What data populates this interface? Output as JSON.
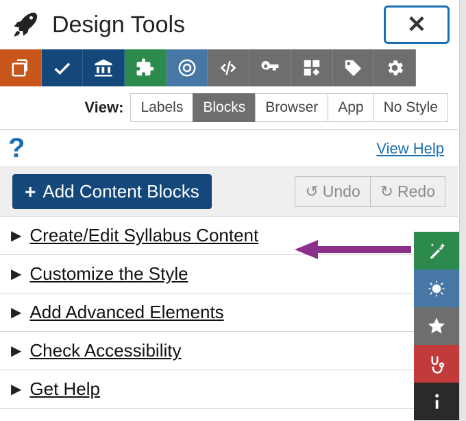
{
  "header": {
    "title": "Design Tools"
  },
  "view": {
    "label": "View:",
    "options": [
      "Labels",
      "Blocks",
      "Browser",
      "App",
      "No Style"
    ],
    "active": "Blocks"
  },
  "help": {
    "icon": "?",
    "link": "View Help"
  },
  "actions": {
    "add_label": "Add Content Blocks",
    "undo_label": "Undo",
    "redo_label": "Redo"
  },
  "accordion": [
    {
      "label": "Create/Edit Syllabus Content"
    },
    {
      "label": "Customize the Style"
    },
    {
      "label": "Add Advanced Elements"
    },
    {
      "label": "Check Accessibility"
    },
    {
      "label": "Get Help"
    }
  ],
  "toolbar_icons": [
    "copy-icon",
    "check-icon",
    "institution-icon",
    "puzzle-icon",
    "target-icon",
    "code-icon",
    "key-icon",
    "blocks-icon",
    "tag-icon",
    "gears-icon"
  ],
  "side_icons": [
    "wand-icon",
    "sun-icon",
    "star-icon",
    "stethoscope-icon",
    "info-icon"
  ],
  "colors": {
    "primary_blue": "#15487a",
    "orange": "#c8561b",
    "green": "#2d8a4d",
    "mid_blue": "#4778a5",
    "gray": "#6e6e6e",
    "red": "#c13b3b",
    "arrow": "#8a2f8a"
  }
}
